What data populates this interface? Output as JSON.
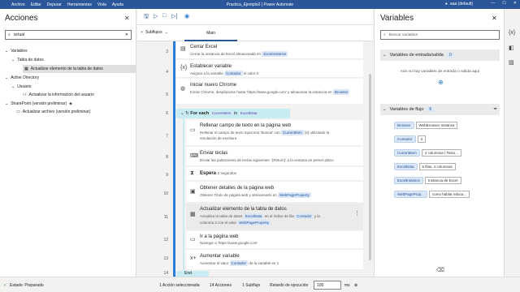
{
  "titlebar": {
    "menu": [
      "Archivo",
      "Editar",
      "Depurar",
      "Herramientas",
      "Vista",
      "Ayuda"
    ],
    "title": "Practica_Ejemplo2 | Power Automate",
    "user": "aaa (default)"
  },
  "actions_panel": {
    "title": "Acciones",
    "search_value": "actual",
    "tree": [
      {
        "label": "Variables",
        "level": 0
      },
      {
        "label": "Tabla de datos",
        "level": 1
      },
      {
        "label": "Actualizar elemento de la tabla de datos",
        "level": 2,
        "selected": true
      },
      {
        "label": "Active Directory",
        "level": 0
      },
      {
        "label": "Usuario",
        "level": 1
      },
      {
        "label": "Actualizar la información del usuario",
        "level": 2
      },
      {
        "label": "SharePoint (versión preliminar)",
        "level": 0
      },
      {
        "label": "Actualizar archivo (versión preliminar)",
        "level": 2
      }
    ]
  },
  "designer": {
    "subflows_label": "Subflujos",
    "main_tab": "Main",
    "steps": [
      {
        "num": "3",
        "title": "Cerrar Excel",
        "desc": "Cerrar la instancia de Excel almacenada en",
        "chips": [
          "ExcelInstance"
        ]
      },
      {
        "num": "4",
        "title": "Establecer variable",
        "desc_a": "Asignar a la variable",
        "chip_a": "Contador",
        "desc_b": "el valor 0"
      },
      {
        "num": "5",
        "title": "Iniciar nuevo Chrome",
        "desc_a": "Iniciar Chrome, desplazarse hasta 'https://www.google.com' y almacenar la instancia en",
        "chip_a": "Browser"
      },
      {
        "num": "6",
        "foreach_label": "For each",
        "chip_a": "CurrentItem",
        "mid": "in",
        "chip_b": "ExcelData"
      },
      {
        "num": "7",
        "title": "Rellenar campo de texto en la página web",
        "desc_a": "Rellenar el campo de texto Input text 'Buscar' con",
        "chip_a": "CurrentItem",
        "desc_b": "[0] utilizando la",
        "desc_c": "emulación de escritura"
      },
      {
        "num": "8",
        "title": "Enviar teclas",
        "desc_a": "Enviar las pulsaciones de teclas siguientes: '{Return}' a la ventana en primer plano"
      },
      {
        "num": "9",
        "title": "Espera",
        "suffix": "2 segundos"
      },
      {
        "num": "10",
        "title": "Obtener detalles de la página web",
        "desc_a": "Obtener Título de página web y almacenarlo en",
        "chip_a": "WebPageProperty"
      },
      {
        "num": "11",
        "title": "Actualizar elemento de la tabla de datos",
        "desc_a": "Actualiza la tabla de datos",
        "chip_a": "ExcelData",
        "desc_b": "en el índice de fila",
        "chip_b": "Contador",
        "desc_c": "y la",
        "desc_d": "columna 3 con el valor",
        "chip_c": "WebPageProperty"
      },
      {
        "num": "12",
        "title": "Ir a la página web",
        "desc_a": "Navegar a 'https://www.google.com'"
      },
      {
        "num": "13",
        "title": "Aumentar variable",
        "desc_a": "Aumentar el valor",
        "chip_a": "Contador",
        "desc_b": "de la variable en 1"
      },
      {
        "num": "14",
        "end_label": "End"
      }
    ]
  },
  "variables_panel": {
    "title": "Variables",
    "search_placeholder": "Buscar variables",
    "io_section": {
      "label": "Variables de entrada/salida",
      "count": "0",
      "empty_text": "Aún no hay variables de entrada o salida aquí"
    },
    "flow_section": {
      "label": "Variables de flujo",
      "count": "6"
    },
    "flow_vars": [
      {
        "name": "Browser",
        "value": "WebBrowser Instance"
      },
      {
        "name": "Contador",
        "value": "3"
      },
      {
        "name": "CurrentItem",
        "value": "4 columnas | Texto..."
      },
      {
        "name": "ExcelData",
        "value": "5 filas, 4 columnas"
      },
      {
        "name": "ExcelInstance",
        "value": "Instancia de Excel"
      },
      {
        "name": "WebPageProp...",
        "value": "como hablar educa..."
      }
    ]
  },
  "statusbar": {
    "status": "Estado: Preparado",
    "selected": "1 Acción seleccionada",
    "actions": "14 Acciones",
    "subflows": "1 Subflujo",
    "delay_label": "Retardo de ejecución",
    "delay_value": "100",
    "delay_unit": "ms"
  },
  "colors": {
    "accent": "#2b579a",
    "chip_bg": "#dce8f7",
    "foreach_bg": "#c7ecf2"
  }
}
